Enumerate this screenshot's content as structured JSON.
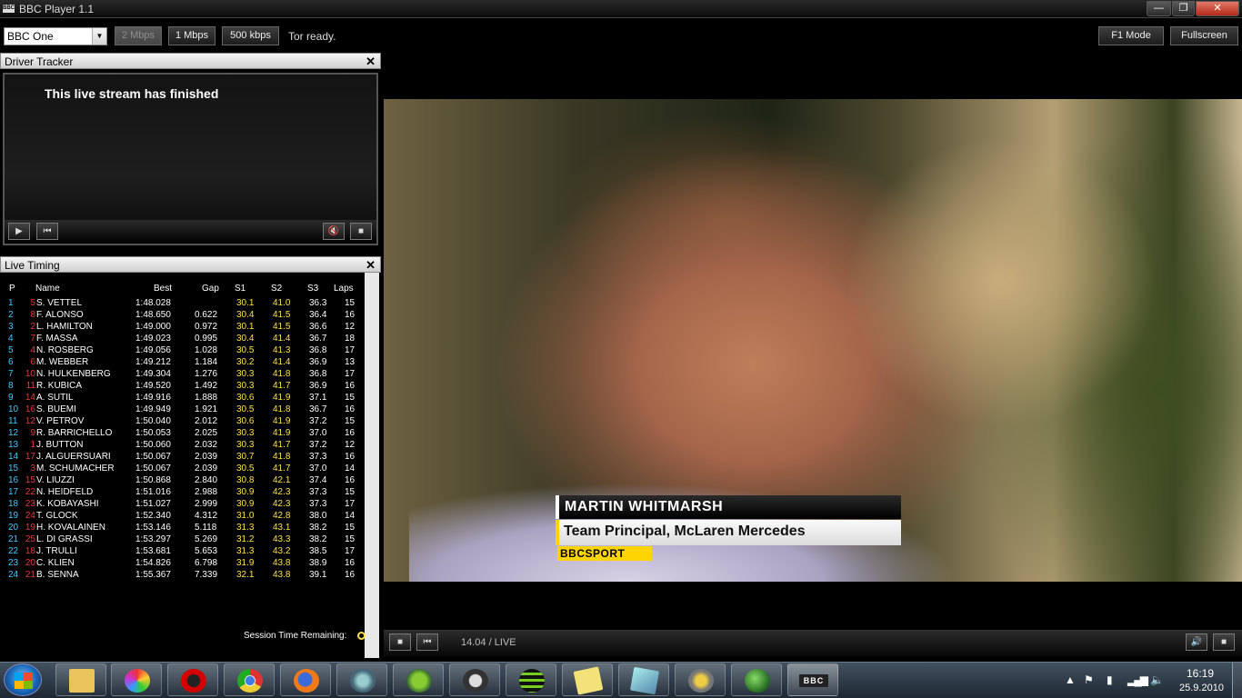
{
  "window": {
    "title": "BBC Player 1.1",
    "logo_text": "BBC",
    "min_glyph": "—",
    "max_glyph": "❐",
    "close_glyph": "✕"
  },
  "toolbar": {
    "channel": "BBC One",
    "buttons": [
      "2 Mbps",
      "1 Mbps",
      "500 kbps"
    ],
    "status": "Tor ready.",
    "f1_mode": "F1 Mode",
    "fullscreen": "Fullscreen"
  },
  "driver_tracker": {
    "title": "Driver Tracker",
    "message": "This live stream has finished",
    "close_glyph": "✕"
  },
  "live_timing": {
    "title": "Live Timing",
    "close_glyph": "✕",
    "columns": {
      "pos": "P",
      "name": "Name",
      "best": "Best",
      "gap": "Gap",
      "s1": "S1",
      "s2": "S2",
      "s3": "S3",
      "laps": "Laps"
    },
    "rows": [
      [
        "1",
        "5",
        "S. VETTEL",
        "1:48.028",
        "",
        "30.1",
        "41.0",
        "36.3",
        "15"
      ],
      [
        "2",
        "8",
        "F. ALONSO",
        "1:48.650",
        "0.622",
        "30.4",
        "41.5",
        "36.4",
        "16"
      ],
      [
        "3",
        "2",
        "L. HAMILTON",
        "1:49.000",
        "0.972",
        "30.1",
        "41.5",
        "36.6",
        "12"
      ],
      [
        "4",
        "7",
        "F. MASSA",
        "1:49.023",
        "0.995",
        "30.4",
        "41.4",
        "36.7",
        "18"
      ],
      [
        "5",
        "4",
        "N. ROSBERG",
        "1:49.056",
        "1.028",
        "30.5",
        "41.3",
        "36.8",
        "17"
      ],
      [
        "6",
        "6",
        "M. WEBBER",
        "1:49.212",
        "1.184",
        "30.2",
        "41.4",
        "36.9",
        "13"
      ],
      [
        "7",
        "10",
        "N. HULKENBERG",
        "1:49.304",
        "1.276",
        "30.3",
        "41.8",
        "36.8",
        "17"
      ],
      [
        "8",
        "11",
        "R. KUBICA",
        "1:49.520",
        "1.492",
        "30.3",
        "41.7",
        "36.9",
        "16"
      ],
      [
        "9",
        "14",
        "A. SUTIL",
        "1:49.916",
        "1.888",
        "30.6",
        "41.9",
        "37.1",
        "15"
      ],
      [
        "10",
        "16",
        "S. BUEMI",
        "1:49.949",
        "1.921",
        "30.5",
        "41.8",
        "36.7",
        "16"
      ],
      [
        "11",
        "12",
        "V. PETROV",
        "1:50.040",
        "2.012",
        "30.6",
        "41.9",
        "37.2",
        "15"
      ],
      [
        "12",
        "9",
        "R. BARRICHELLO",
        "1:50.053",
        "2.025",
        "30.3",
        "41.9",
        "37.0",
        "16"
      ],
      [
        "13",
        "1",
        "J. BUTTON",
        "1:50.060",
        "2.032",
        "30.3",
        "41.7",
        "37.2",
        "12"
      ],
      [
        "14",
        "17",
        "J. ALGUERSUARI",
        "1:50.067",
        "2.039",
        "30.7",
        "41.8",
        "37.3",
        "16"
      ],
      [
        "15",
        "3",
        "M. SCHUMACHER",
        "1:50.067",
        "2.039",
        "30.5",
        "41.7",
        "37.0",
        "14"
      ],
      [
        "16",
        "15",
        "V. LIUZZI",
        "1:50.868",
        "2.840",
        "30.8",
        "42.1",
        "37.4",
        "16"
      ],
      [
        "17",
        "22",
        "N. HEIDFELD",
        "1:51.016",
        "2.988",
        "30.9",
        "42.3",
        "37.3",
        "15"
      ],
      [
        "18",
        "23",
        "K. KOBAYASHI",
        "1:51.027",
        "2.999",
        "30.9",
        "42.3",
        "37.3",
        "17"
      ],
      [
        "19",
        "24",
        "T. GLOCK",
        "1:52.340",
        "4.312",
        "31.0",
        "42.8",
        "38.0",
        "14"
      ],
      [
        "20",
        "19",
        "H. KOVALAINEN",
        "1:53.146",
        "5.118",
        "31.3",
        "43.1",
        "38.2",
        "15"
      ],
      [
        "21",
        "25",
        "L. DI GRASSI",
        "1:53.297",
        "5.269",
        "31.2",
        "43.3",
        "38.2",
        "15"
      ],
      [
        "22",
        "18",
        "J. TRULLI",
        "1:53.681",
        "5.653",
        "31.3",
        "43.2",
        "38.5",
        "17"
      ],
      [
        "23",
        "20",
        "C. KLIEN",
        "1:54.826",
        "6.798",
        "31.9",
        "43.8",
        "38.9",
        "16"
      ],
      [
        "24",
        "21",
        "B. SENNA",
        "1:55.367",
        "7.339",
        "32.1",
        "43.8",
        "39.1",
        "16"
      ]
    ],
    "session_label": "Session Time Remaining:"
  },
  "video": {
    "caption_name": "MARTIN WHITMARSH",
    "caption_title": "Team Principal, McLaren Mercedes",
    "caption_brand": "BBCSPORT",
    "time": "14.04 / LIVE"
  },
  "taskbar": {
    "bbc_label": "BBC",
    "time": "16:19",
    "date": "25.9.2010"
  },
  "colors": {
    "driver_number": "#e43c3c",
    "position": "#44c8ff",
    "sector": "#ffe14a",
    "caption_accent": "#ffd400"
  }
}
